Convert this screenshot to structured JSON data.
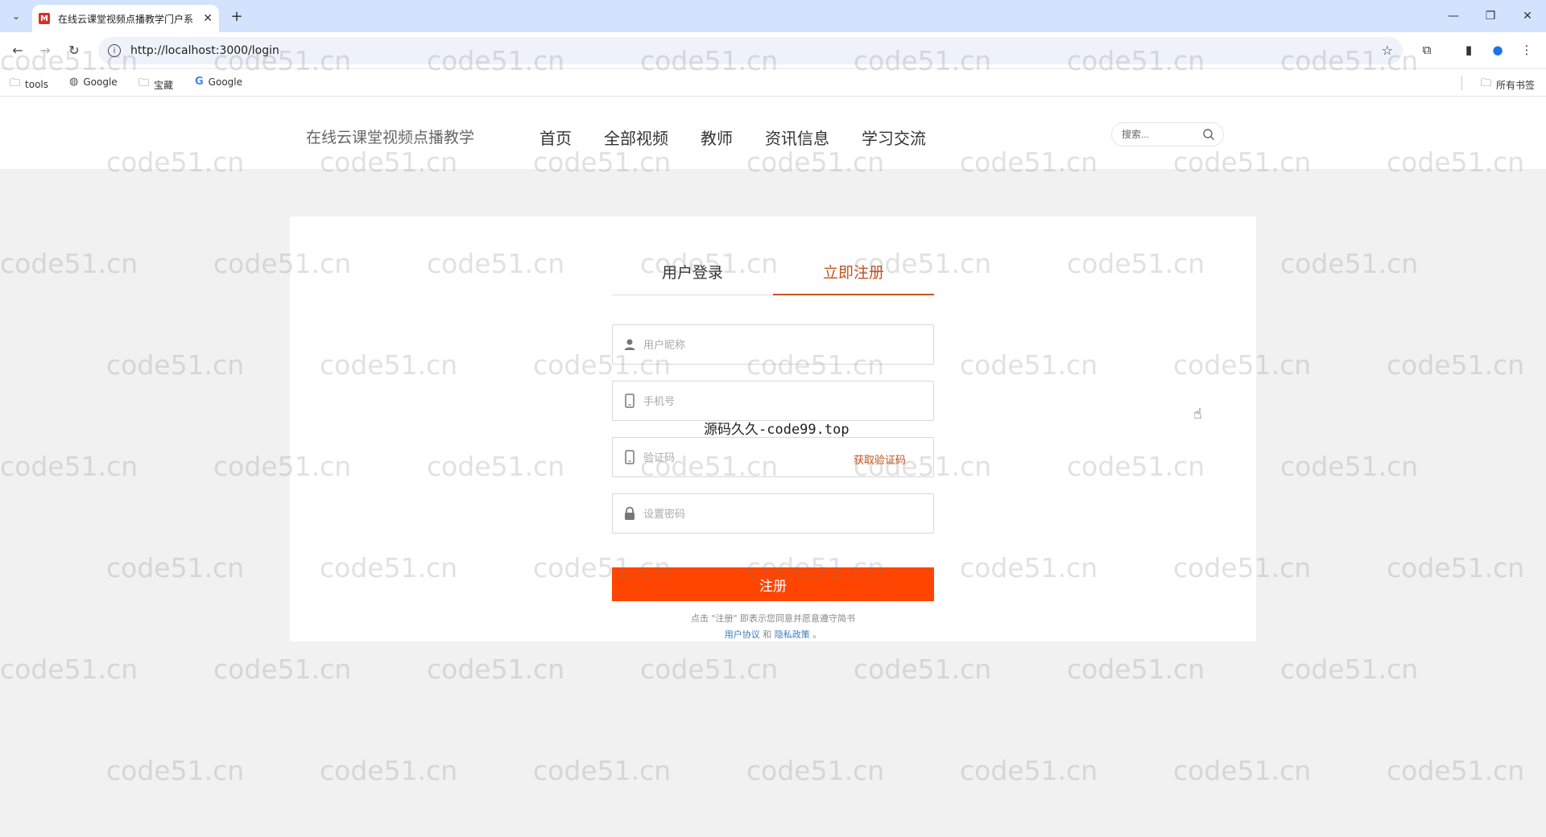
{
  "browser": {
    "tab_title": "在线云课堂视频点播教学门户系",
    "favicon_letter": "M",
    "url": "http://localhost:3000/login",
    "bookmarks": [
      {
        "label": "tools",
        "icon": "folder-icon"
      },
      {
        "label": "Google",
        "icon": "globe-icon"
      },
      {
        "label": "宝藏",
        "icon": "folder-icon"
      },
      {
        "label": "Google",
        "icon": "google-icon"
      }
    ],
    "all_bookmarks_label": "所有书签"
  },
  "site": {
    "title": "在线云课堂视频点播教学",
    "nav": [
      "首页",
      "全部视频",
      "教师",
      "资讯信息",
      "学习交流"
    ],
    "search_placeholder": "搜索..."
  },
  "form": {
    "tabs": [
      {
        "label": "用户登录",
        "active": false
      },
      {
        "label": "立即注册",
        "active": true
      }
    ],
    "fields": {
      "nickname_placeholder": "用户昵称",
      "phone_placeholder": "手机号",
      "code_placeholder": "验证码",
      "password_placeholder": "设置密码"
    },
    "get_code_label": "获取验证码",
    "submit_label": "注册",
    "agree_text": "点击 \"注册\" 即表示您同意并愿意遵守简书",
    "agree_link1": "用户协议",
    "agree_and": "和",
    "agree_link2": "隐私政策",
    "agree_end": "。"
  },
  "overlay_text": "源码久久-code99.top",
  "watermark_text": "code51.cn",
  "colors": {
    "accent": "#c4541f",
    "button": "#ff4500",
    "link": "#3a7bbf"
  }
}
